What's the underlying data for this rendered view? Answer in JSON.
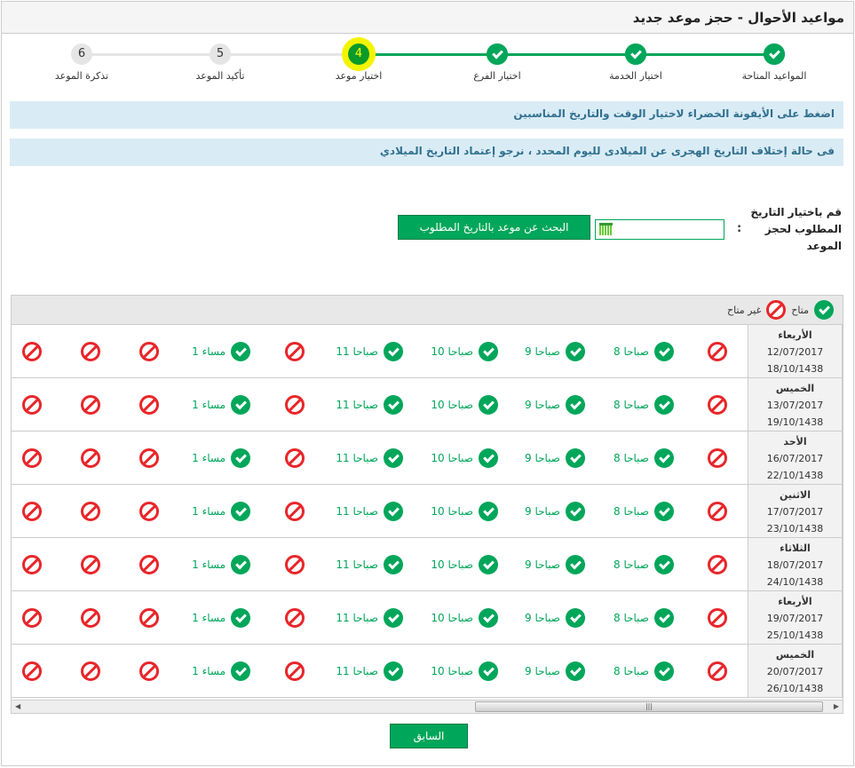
{
  "header": {
    "title": "مواعيد الأحوال - حجز موعد جديد"
  },
  "steps": [
    {
      "label": "المواعيد المتاحة",
      "state": "done",
      "icon": "check-icon"
    },
    {
      "label": "اختيار الخدمة",
      "state": "done",
      "icon": "check-icon"
    },
    {
      "label": "اختيار الفرع",
      "state": "done",
      "icon": "check-icon"
    },
    {
      "label": "اختيار موعد",
      "state": "current",
      "number": "4"
    },
    {
      "label": "تأكيد الموعد",
      "state": "pending",
      "number": "5"
    },
    {
      "label": "تذكرة الموعد",
      "state": "pending",
      "number": "6"
    }
  ],
  "info": {
    "line1": "اضغط على الأيقونة الخضراء لاختيار الوقت والتاريخ المناسبين",
    "line2": "فى حالة إختلاف التاريخ الهجرى عن الميلادى لليوم المحدد ، نرجو إعتماد التاريخ الميلادي"
  },
  "form": {
    "label": "قم باختيار التاريخ المطلوب لحجز الموعد",
    "colon": ":",
    "date_value": "",
    "search_button": "البحث عن موعد بالتاريخ المطلوب"
  },
  "legend": {
    "available": "متاح",
    "unavailable": "غير متاح"
  },
  "slots": [
    {
      "available": false
    },
    {
      "available": true,
      "label": "8 صباحا"
    },
    {
      "available": true,
      "label": "9 صباحا"
    },
    {
      "available": true,
      "label": "10 صباحا"
    },
    {
      "available": true,
      "label": "11 صباحا"
    },
    {
      "available": false
    },
    {
      "available": true,
      "label": "1 مساء"
    },
    {
      "available": false
    },
    {
      "available": false
    },
    {
      "available": false
    }
  ],
  "days": [
    {
      "day": "الأربعاء",
      "gregorian": "12/07/2017",
      "hijri": "18/10/1438"
    },
    {
      "day": "الخميس",
      "gregorian": "13/07/2017",
      "hijri": "19/10/1438"
    },
    {
      "day": "الأحد",
      "gregorian": "16/07/2017",
      "hijri": "22/10/1438"
    },
    {
      "day": "الاثنين",
      "gregorian": "17/07/2017",
      "hijri": "23/10/1438"
    },
    {
      "day": "الثلاثاء",
      "gregorian": "18/07/2017",
      "hijri": "24/10/1438"
    },
    {
      "day": "الأربعاء",
      "gregorian": "19/07/2017",
      "hijri": "25/10/1438"
    },
    {
      "day": "الخميس",
      "gregorian": "20/07/2017",
      "hijri": "26/10/1438"
    }
  ],
  "footer": {
    "back_button": "السابق"
  },
  "colors": {
    "green": "#00a65a",
    "red": "#e8262a",
    "highlight": "#f4f400",
    "info_bg": "#d9ecf5"
  }
}
